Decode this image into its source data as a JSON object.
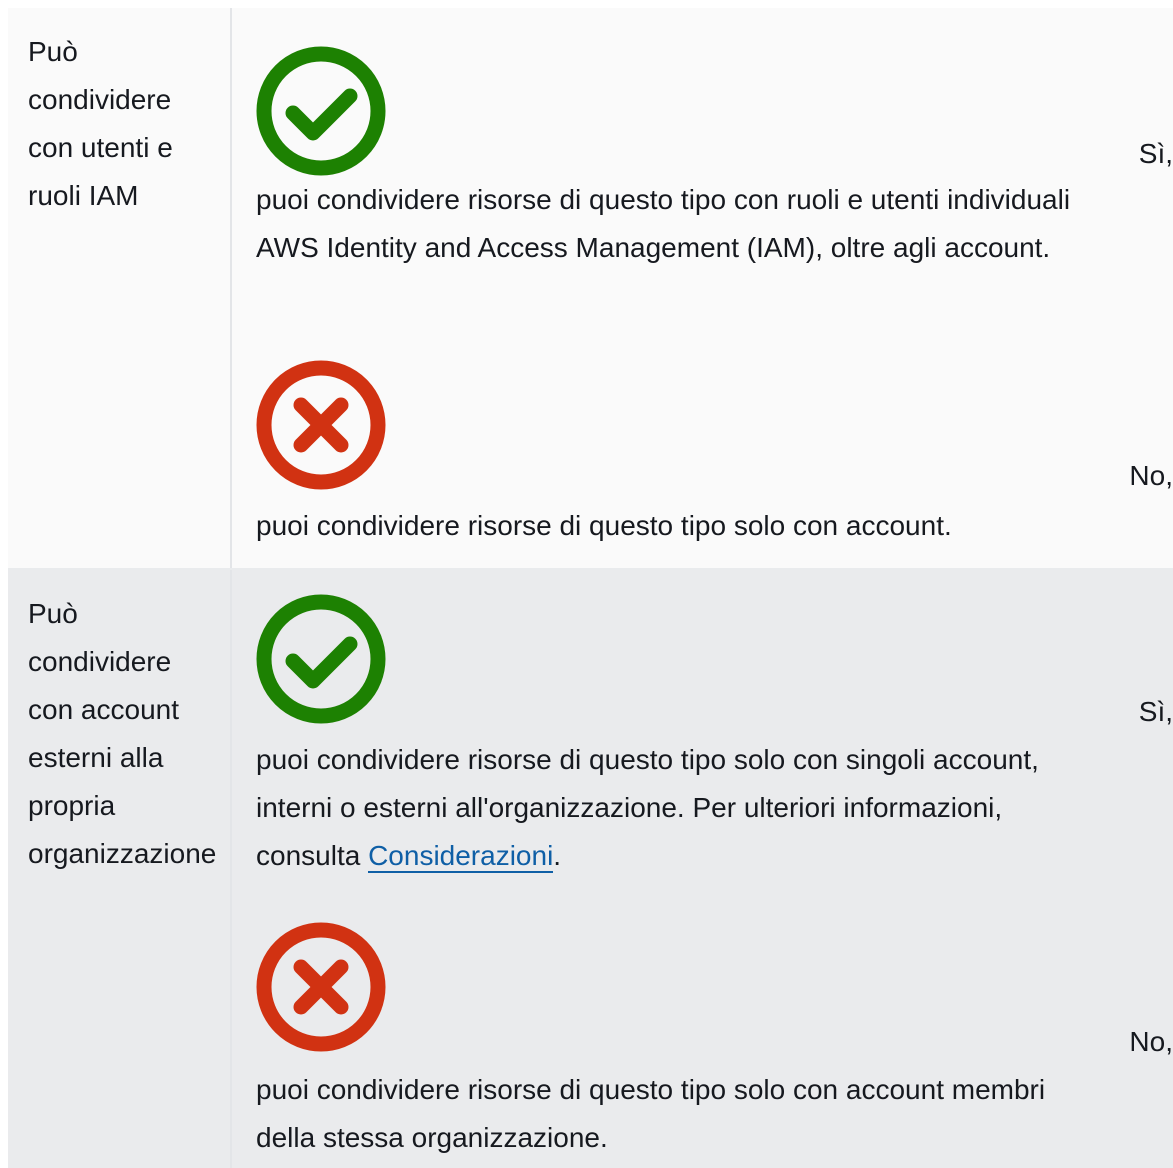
{
  "rows": [
    {
      "label": "Può condividere con utenti e ruoli IAM",
      "yes": {
        "answer": "Sì,",
        "description": "puoi condividere risorse di questo tipo con ruoli e utenti individuali AWS Identity and Access Management (IAM), oltre agli account.",
        "icon": "check-circle-icon",
        "color": "#1d8102"
      },
      "no": {
        "answer": "No,",
        "description": "puoi condividere risorse di questo tipo solo con account.",
        "icon": "x-circle-icon",
        "color": "#d13212"
      }
    },
    {
      "label": "Può condividere con account esterni alla propria organizzazione",
      "yes": {
        "answer": "Sì,",
        "description_before_link": "puoi condividere risorse di questo tipo solo con singoli account, interni o esterni all'organizzazione. Per ulteriori informazioni, consulta ",
        "link_text": "Considerazioni",
        "description_after_link": ".",
        "icon": "check-circle-icon",
        "color": "#1d8102"
      },
      "no": {
        "answer": "No,",
        "description": "puoi condividere risorse di questo tipo solo con account membri della stessa organizzazione.",
        "icon": "x-circle-icon",
        "color": "#d13212"
      }
    }
  ]
}
